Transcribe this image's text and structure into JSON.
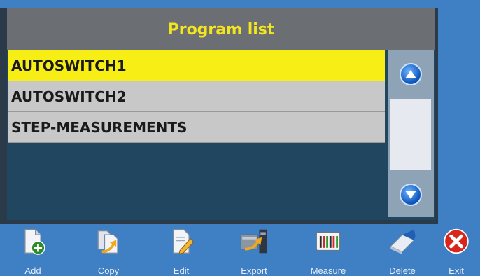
{
  "dialog": {
    "title": "Program list",
    "items": [
      {
        "label": "AUTOSWITCH1",
        "selected": true
      },
      {
        "label": "AUTOSWITCH2",
        "selected": false
      },
      {
        "label": "STEP-MEASUREMENTS",
        "selected": false
      }
    ],
    "scroll_up_icon": "arrow-up-circle-icon",
    "scroll_down_icon": "arrow-down-circle-icon"
  },
  "toolbar": {
    "add": {
      "label": "Add",
      "icon": "add-document-icon"
    },
    "copy": {
      "label": "Copy",
      "icon": "copy-document-icon"
    },
    "edit": {
      "label": "Edit",
      "icon": "edit-document-icon"
    },
    "export": {
      "label": "Export",
      "icon": "export-icon"
    },
    "measure": {
      "label": "Measure",
      "icon": "measure-icon"
    },
    "delete": {
      "label": "Delete",
      "icon": "eraser-icon"
    },
    "exit": {
      "label": "Exit",
      "icon": "exit-icon"
    }
  },
  "colors": {
    "title_text": "#f4e61e",
    "selected_row": "#f6ee14",
    "row": "#c8c8c8",
    "background": "#3f7fc3"
  }
}
